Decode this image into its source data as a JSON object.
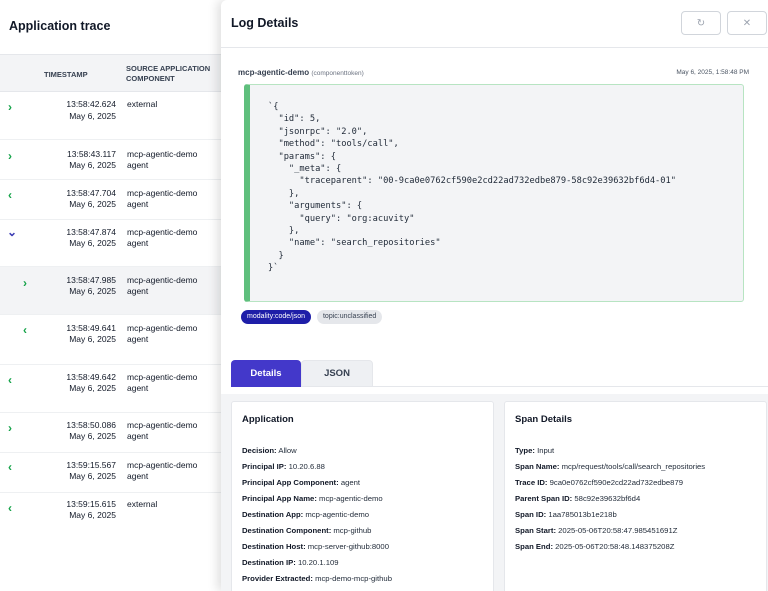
{
  "left": {
    "title": "Application trace",
    "columns": {
      "timestamp": "TIMESTAMP",
      "source": "SOURCE APPLICATION COMPONENT"
    },
    "rows": [
      {
        "time": "13:58:42.624",
        "date": "May 6, 2025",
        "src1": "external",
        "src2": "",
        "chevron": "›"
      },
      {
        "time": "13:58:43.117",
        "date": "May 6, 2025",
        "src1": "mcp-agentic-demo",
        "src2": "agent",
        "chevron": "›"
      },
      {
        "time": "13:58:47.704",
        "date": "May 6, 2025",
        "src1": "mcp-agentic-demo",
        "src2": "agent",
        "chevron": "‹"
      },
      {
        "time": "13:58:47.874",
        "date": "May 6, 2025",
        "src1": "mcp-agentic-demo",
        "src2": "agent",
        "chevron": "⌄"
      },
      {
        "time": "13:58:47.985",
        "date": "May 6, 2025",
        "src1": "mcp-agentic-demo",
        "src2": "agent",
        "chevron": "›"
      },
      {
        "time": "13:58:49.641",
        "date": "May 6, 2025",
        "src1": "mcp-agentic-demo",
        "src2": "agent",
        "chevron": "‹"
      },
      {
        "time": "13:58:49.642",
        "date": "May 6, 2025",
        "src1": "mcp-agentic-demo",
        "src2": "agent",
        "chevron": "‹"
      },
      {
        "time": "13:58:50.086",
        "date": "May 6, 2025",
        "src1": "mcp-agentic-demo",
        "src2": "agent",
        "chevron": "›"
      },
      {
        "time": "13:59:15.567",
        "date": "May 6, 2025",
        "src1": "mcp-agentic-demo",
        "src2": "agent",
        "chevron": "‹"
      },
      {
        "time": "13:59:15.615",
        "date": "May 6, 2025",
        "src1": "external",
        "src2": "",
        "chevron": "‹"
      }
    ]
  },
  "drawer": {
    "title": "Log Details",
    "refresh_icon": "refresh-icon",
    "close_icon": "close-icon",
    "refresh_glyph": "↻",
    "close_glyph": "✕",
    "message": {
      "component": "mcp-agentic-demo",
      "component_sub": "(componenttoken)",
      "time": "May 6, 2025, 1:58:48 PM",
      "code": "`{\n  \"id\": 5,\n  \"jsonrpc\": \"2.0\",\n  \"method\": \"tools/call\",\n  \"params\": {\n    \"_meta\": {\n      \"traceparent\": \"00-9ca0e0762cf590e2cd22ad732edbe879-58c92e39632bf6d4-01\"\n    },\n    \"arguments\": {\n      \"query\": \"org:acuvity\"\n    },\n    \"name\": \"search_repositories\"\n  }\n}`"
    },
    "tags": [
      "modality:code/json",
      "topic:unclassified"
    ],
    "tabs": {
      "details": "Details",
      "json": "JSON"
    },
    "application": {
      "title": "Application",
      "fields": [
        {
          "k": "Decision:",
          "v": "Allow"
        },
        {
          "k": "Principal IP:",
          "v": "10.20.6.88"
        },
        {
          "k": "Principal App Component:",
          "v": "agent"
        },
        {
          "k": "Principal App Name:",
          "v": "mcp-agentic-demo"
        },
        {
          "k": "Destination App:",
          "v": "mcp-agentic-demo"
        },
        {
          "k": "Destination Component:",
          "v": "mcp-github"
        },
        {
          "k": "Destination Host:",
          "v": "mcp-server-github:8000"
        },
        {
          "k": "Destination IP:",
          "v": "10.20.1.109"
        },
        {
          "k": "Provider Extracted:",
          "v": "mcp-demo-mcp-github"
        }
      ]
    },
    "span": {
      "title": "Span Details",
      "fields": [
        {
          "k": "Type:",
          "v": "Input"
        },
        {
          "k": "Span Name:",
          "v": "mcp/request/tools/call/search_repositories"
        },
        {
          "k": "Trace ID:",
          "v": "9ca0e0762cf590e2cd22ad732edbe879"
        },
        {
          "k": "Parent Span ID:",
          "v": "58c92e39632bf6d4"
        },
        {
          "k": "Span ID:",
          "v": "1aa785013b1e218b"
        },
        {
          "k": "Span Start:",
          "v": "2025-05-06T20:58:47.985451691Z"
        },
        {
          "k": "Span End:",
          "v": "2025-05-06T20:58:48.148375208Z"
        }
      ]
    }
  }
}
